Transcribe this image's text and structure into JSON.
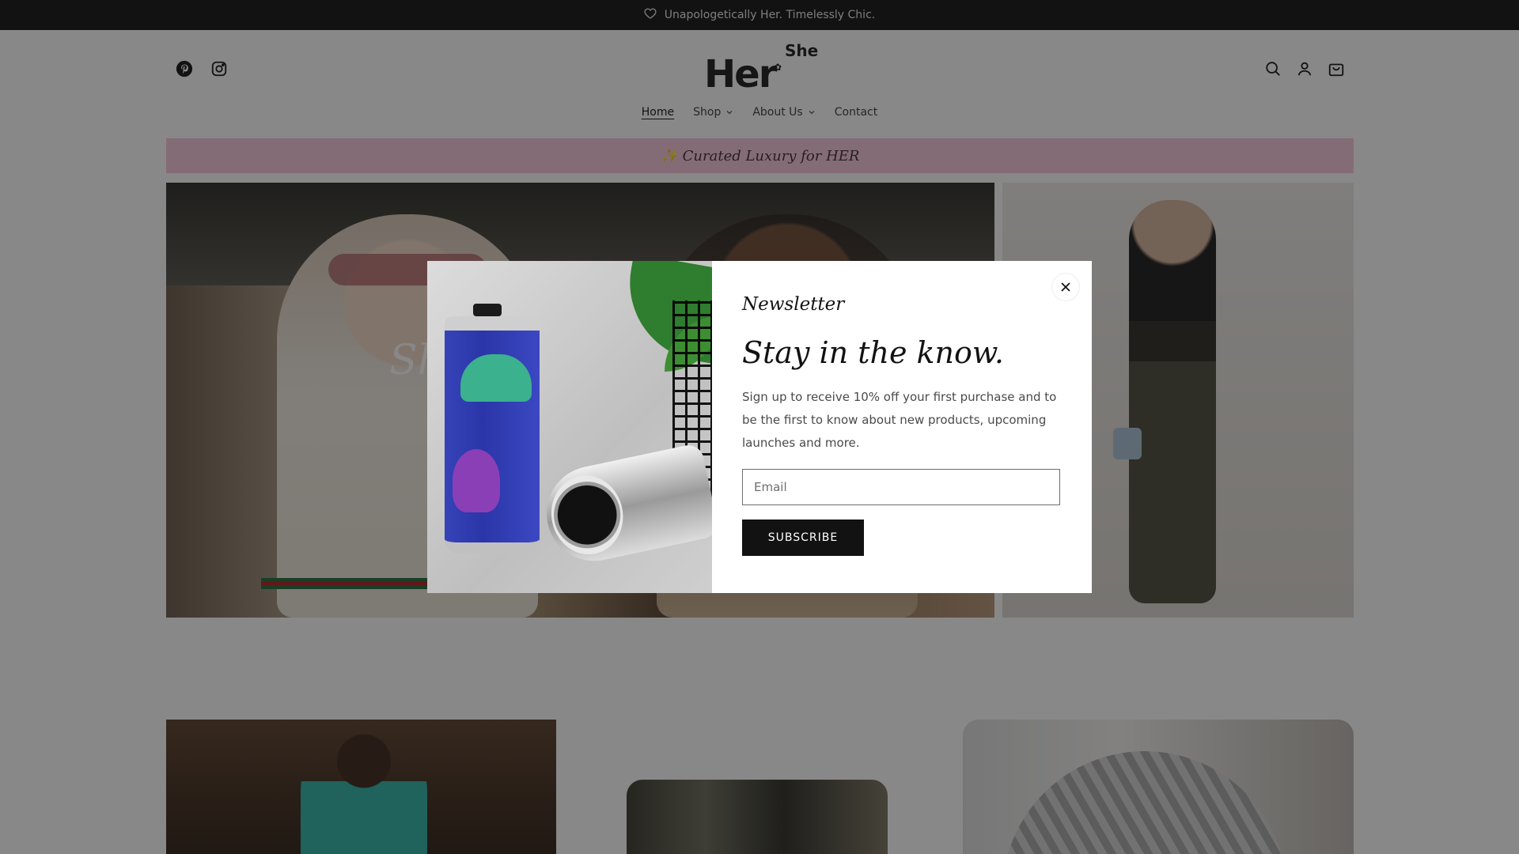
{
  "announcement": {
    "text": "Unapologetically Her. Timelessly Chic.",
    "icon": "heart-icon"
  },
  "logo": {
    "main": "Her",
    "sup": "She"
  },
  "social": [
    {
      "name": "pinterest-icon"
    },
    {
      "name": "instagram-icon"
    }
  ],
  "header_icons": [
    {
      "name": "search-icon"
    },
    {
      "name": "account-icon"
    },
    {
      "name": "cart-icon"
    }
  ],
  "nav": {
    "home": "Home",
    "shop": "Shop",
    "about": "About Us",
    "contact": "Contact"
  },
  "promo": {
    "text": "✨ Curated Luxury for HER"
  },
  "hero": {
    "partial_text": "Sh"
  },
  "modal": {
    "eyebrow": "Newsletter",
    "headline": "Stay in the know.",
    "description": "Sign up to receive 10% off your first purchase and to be the first to know about new products, upcoming launches and more.",
    "email_placeholder": "Email",
    "subscribe_label": "SUBSCRIBE",
    "close_icon": "close-icon"
  },
  "colors": {
    "promo_bg": "#f7c6dc",
    "overlay": "rgba(18,18,18,0.5)",
    "button_bg": "#121212"
  }
}
